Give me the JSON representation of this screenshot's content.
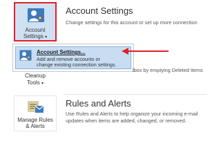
{
  "account_settings": {
    "button_label_line1": "Account",
    "button_label_line2": "Settings",
    "dropdown_caret": "▾",
    "title": "Account Settings",
    "description": "Change settings for this account or set up more connection"
  },
  "menu": {
    "item_title": "Account Settings...",
    "item_desc_line1": "Add and remove accounts or",
    "item_desc_line2": "change existing connection settings."
  },
  "cleanup": {
    "button_label_line1": "Cleanup",
    "button_label_line2": "Tools",
    "dropdown_caret": "▾",
    "partial_description": "lbox by emptying Deleted Items"
  },
  "rules": {
    "button_label_line1": "Manage Rules",
    "button_label_line2": "& Alerts",
    "title": "Rules and Alerts",
    "description_line1": "Use Rules and Alerts to help organize your incoming e-mail",
    "description_line2": "updates when items are added, changed, or removed."
  },
  "colors": {
    "highlight_border": "#e0202a",
    "menu_selected_bg": "#c8ddf2",
    "button_selected_bg": "#cfe0f3"
  }
}
